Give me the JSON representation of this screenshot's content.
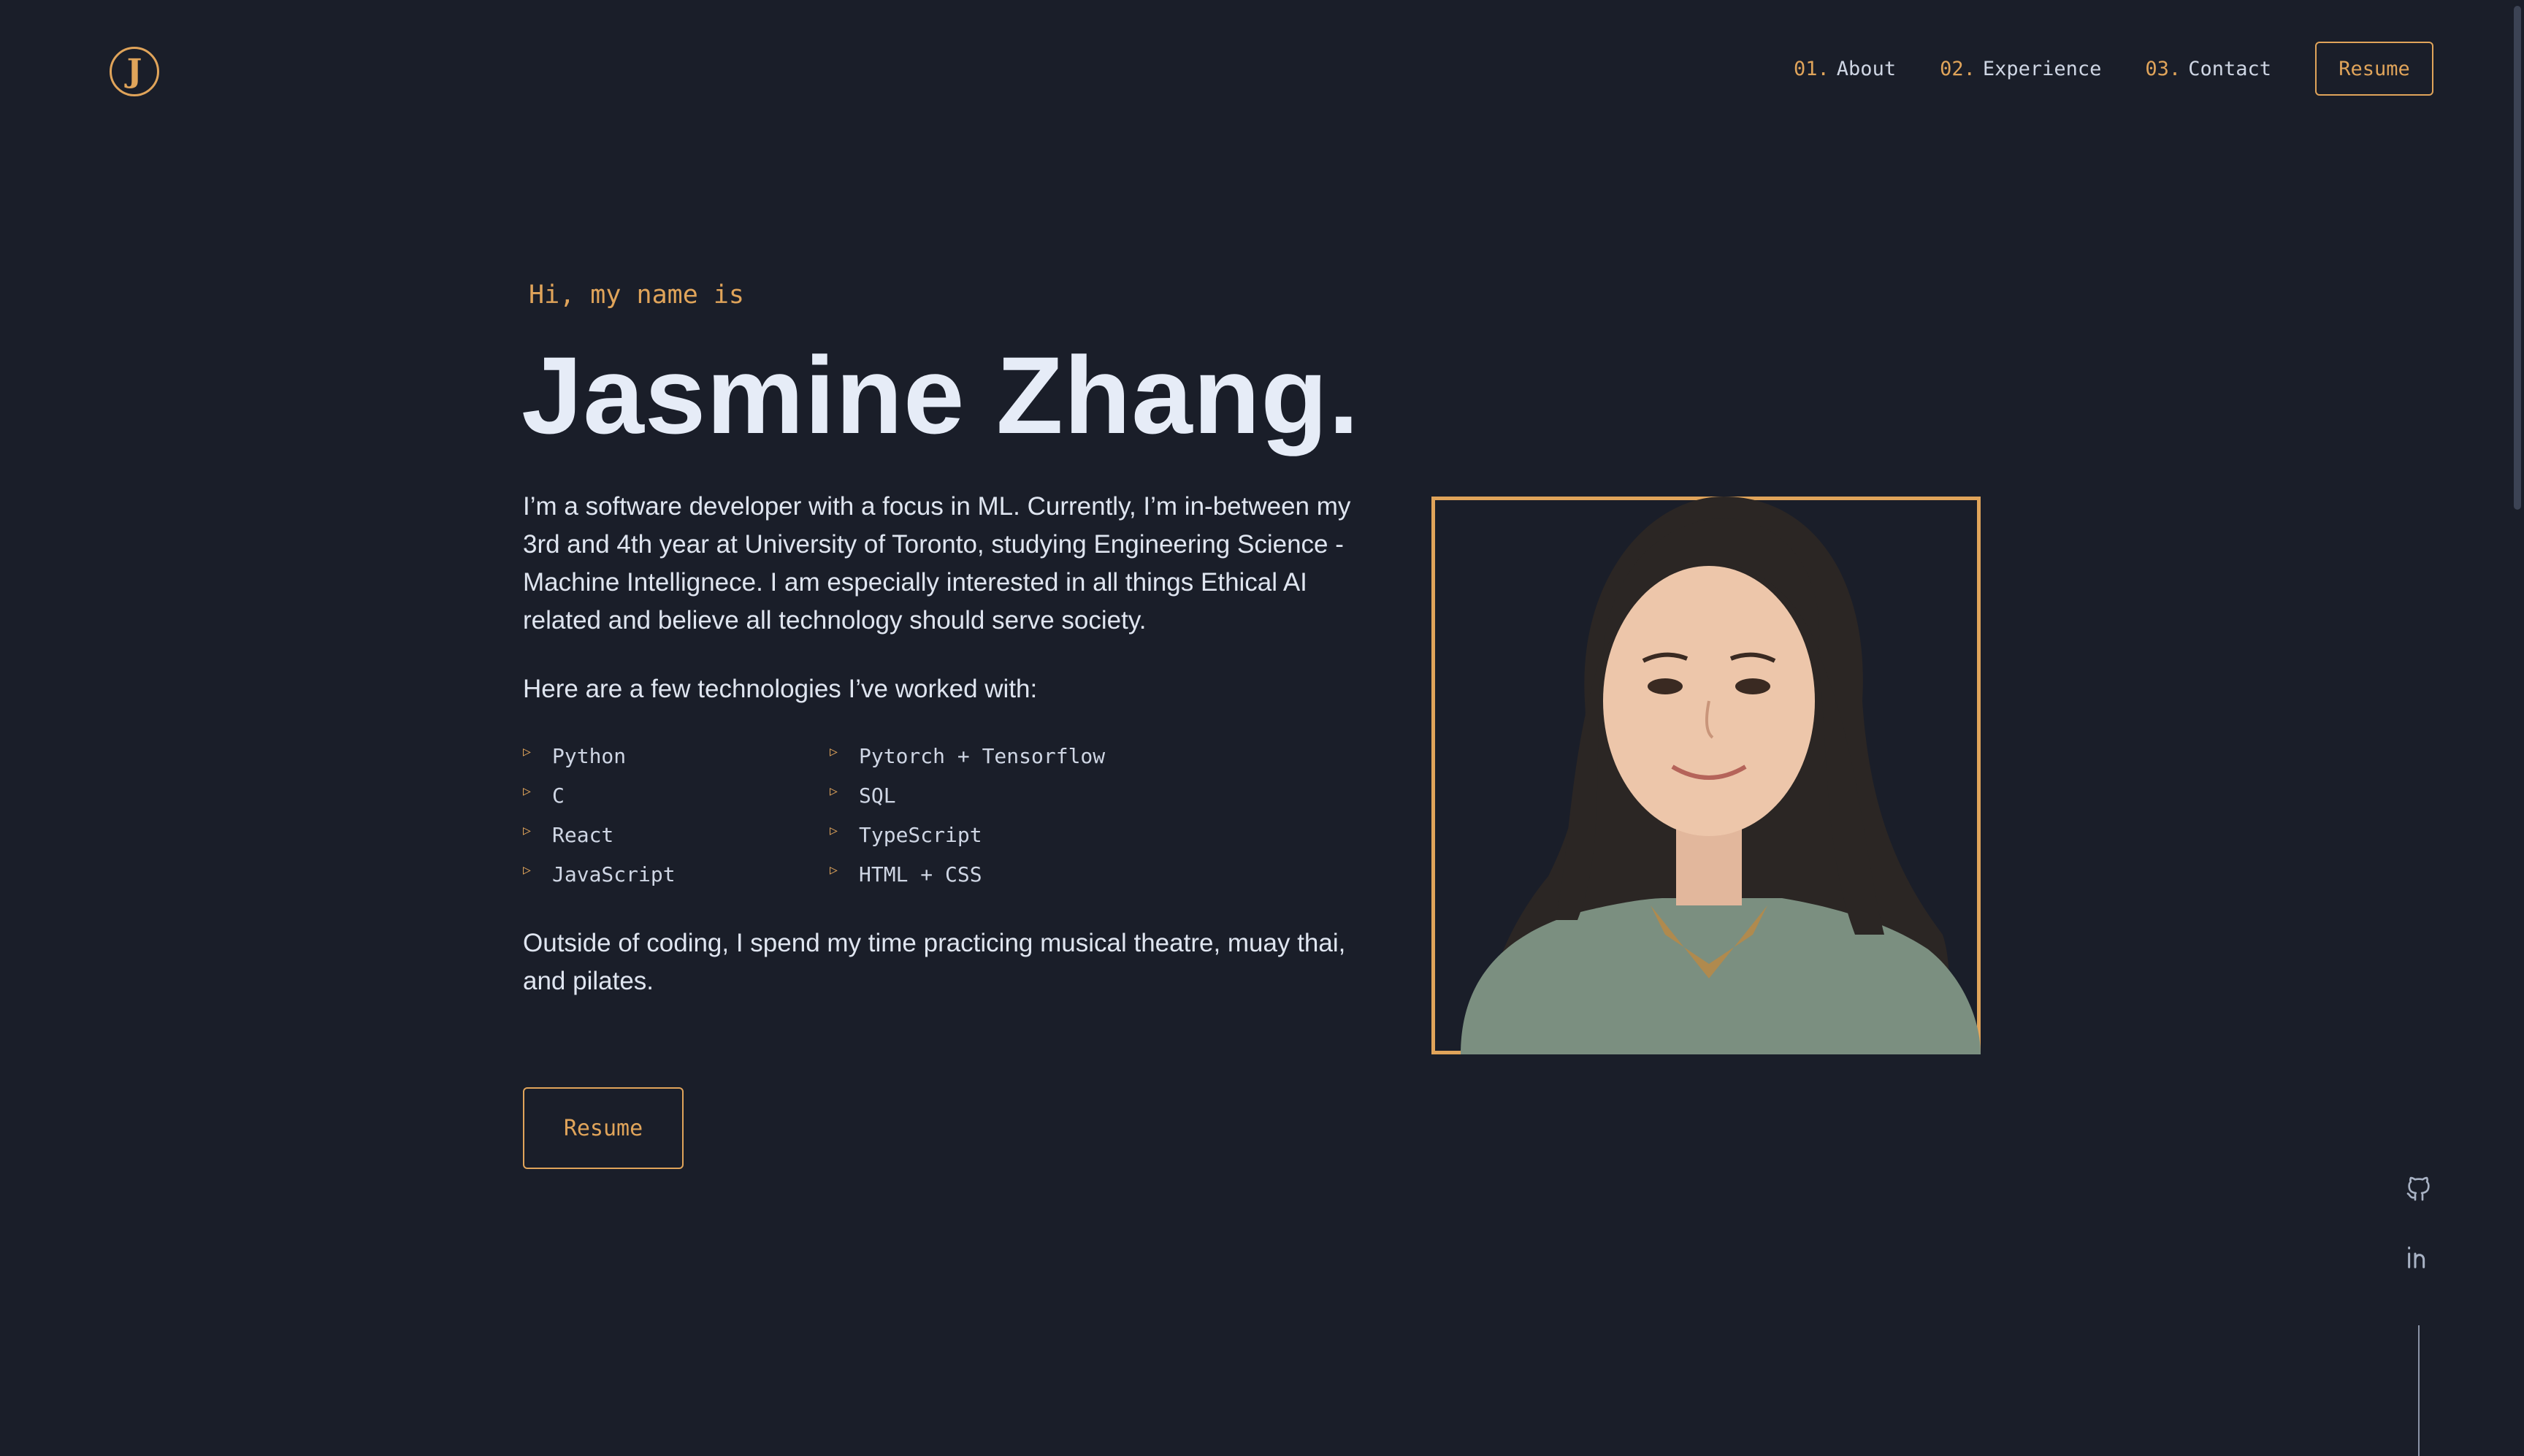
{
  "logo": {
    "letter": "J"
  },
  "nav": {
    "items": [
      {
        "num": "01.",
        "label": "About"
      },
      {
        "num": "02.",
        "label": "Experience"
      },
      {
        "num": "03.",
        "label": "Contact"
      }
    ],
    "resume_label": "Resume"
  },
  "hero": {
    "greeting": "Hi, my name is",
    "name": "Jasmine Zhang.",
    "bio": "I’m a software developer with a focus in ML. Currently, I’m in-between my 3rd and 4th year at University of Toronto, studying Engineering Science - Machine Intellignece. I am especially interested in all things Ethical AI related and believe all technology should serve society.",
    "tech_intro": "Here are a few technologies I’ve worked with:",
    "technologies": [
      "Python",
      "Pytorch + Tensorflow",
      "C",
      "SQL",
      "React",
      "TypeScript",
      "JavaScript",
      "HTML + CSS"
    ],
    "outside": "Outside of coding, I spend my time practicing musical theatre, muay thai, and pilates.",
    "resume_label": "Resume"
  },
  "social": {
    "icons": [
      "github-icon",
      "linkedin-icon"
    ]
  },
  "colors": {
    "background": "#1a1e29",
    "accent": "#e0a45a",
    "text": "#e6ecf7"
  }
}
